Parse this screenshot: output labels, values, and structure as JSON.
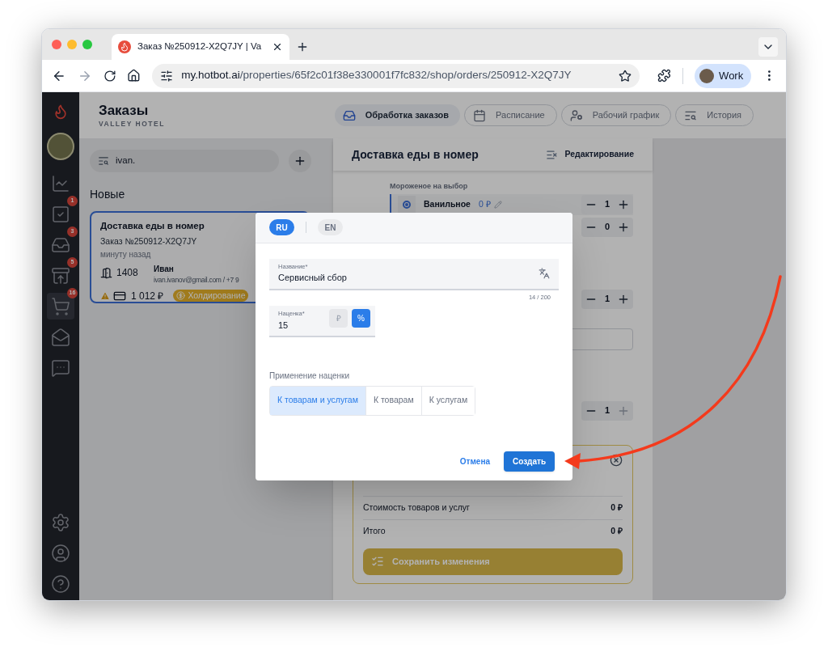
{
  "browser": {
    "tab_title": "Заказ №250912-X2Q7JY | Va",
    "url_host": "my.hotbot.ai",
    "url_path": "/properties/65f2c01f38e330001f7fc832/shop/orders/250912-X2Q7JY",
    "profile": "Work"
  },
  "sidebar": {
    "items": [
      {
        "selected": false
      },
      {
        "badge": "1",
        "selected": false
      },
      {
        "badge": "3",
        "selected": false
      },
      {
        "badge": "5",
        "selected": false
      },
      {
        "badge": "16",
        "selected": true
      },
      {
        "selected": false
      },
      {
        "selected": false
      }
    ]
  },
  "header": {
    "title": "Заказы",
    "subtitle": "VALLEY HOTEL",
    "tabs": [
      {
        "label": "Обработка заказов",
        "selected": true
      },
      {
        "label": "Расписание",
        "selected": false
      },
      {
        "label": "Рабочий график",
        "selected": false
      },
      {
        "label": "История",
        "selected": false
      }
    ]
  },
  "search": {
    "value": "ivan."
  },
  "orders_section": {
    "title": "Новые",
    "orders": [
      {
        "title": "Доставка еды в номер",
        "number": "Заказ №250912-X2Q7JY",
        "time": "минуту назад",
        "room": "1408",
        "guest_name": "Иван",
        "guest_contact": "ivan.ivanov@gmail.com / +7 9",
        "warning": true,
        "amount": "1 012 ₽",
        "status": "Холдирование",
        "selected": true
      }
    ]
  },
  "order_panel": {
    "title": "Доставка еды в номер",
    "edit_button": "Редактирование",
    "option_group": "Мороженое на выбор",
    "options": [
      {
        "label": "Ванильное",
        "price": "0 ₽",
        "selected": true,
        "quantity": "1",
        "plus_disabled": false
      },
      {
        "quantity": "0",
        "plus_disabled": false
      }
    ],
    "steppers": [
      {
        "quantity": "1",
        "plus_disabled": false
      },
      {
        "quantity": "1",
        "plus_disabled": true
      }
    ],
    "summary": {
      "rows": [
        {
          "label": "Стоимость товаров и услуг",
          "value": "0 ₽"
        },
        {
          "label": "Итого",
          "value": "0 ₽"
        }
      ],
      "save_button": {
        "label": "Сохранить изменения",
        "disabled": true
      }
    }
  },
  "dialog": {
    "languages": [
      {
        "label": "RU",
        "selected": true
      },
      {
        "label": "EN",
        "selected": false
      }
    ],
    "name_field": {
      "label": "Название*",
      "value": "Сервисный сбор",
      "counter": "14 / 200"
    },
    "markup_field": {
      "label": "Наценка*",
      "value": "15",
      "units": [
        {
          "label": "₽",
          "selected": false
        },
        {
          "label": "%",
          "selected": true
        }
      ]
    },
    "apply_label": "Применение наценки",
    "apply_options": [
      {
        "label": "К товарам и услугам",
        "selected": true
      },
      {
        "label": "К товарам",
        "selected": false
      },
      {
        "label": "К услугам",
        "selected": false
      }
    ],
    "cancel": "Отмена",
    "submit": "Создать"
  }
}
